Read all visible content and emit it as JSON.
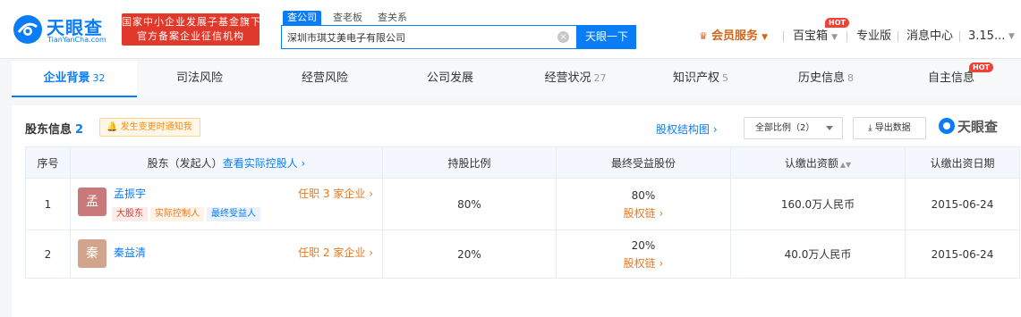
{
  "header": {
    "logo_cn": "天眼查",
    "logo_en": "TianYanCha.com",
    "slogan_line1": "国家中小企业发展子基金旗下",
    "slogan_line2": "官方备案企业征信机构",
    "search_tabs": [
      "查公司",
      "查老板",
      "查关系"
    ],
    "search_value": "深圳市琪艾美电子有限公司",
    "search_button": "天眼一下",
    "vip_label": "会员服务",
    "baibaoxiang": "百宝箱",
    "hot_badge": "HOT",
    "pro_version": "专业版",
    "message_center": "消息中心",
    "user_truncated": "3.15..."
  },
  "tabs": [
    {
      "label": "企业背景",
      "count": "32",
      "active": true
    },
    {
      "label": "司法风险",
      "count": ""
    },
    {
      "label": "经营风险",
      "count": ""
    },
    {
      "label": "公司发展",
      "count": ""
    },
    {
      "label": "经营状况",
      "count": "27"
    },
    {
      "label": "知识产权",
      "count": "5"
    },
    {
      "label": "历史信息",
      "count": "8"
    },
    {
      "label": "自主信息",
      "count": ""
    }
  ],
  "tab_hot_badge": "HOT",
  "section": {
    "title": "股东信息",
    "count": "2",
    "notify_label": "发生变更时通知我",
    "equity_chart_link": "股权结构图",
    "ratio_select": "全部比例（2）",
    "export_label": "导出数据",
    "watermark": "天眼查"
  },
  "table": {
    "headers": {
      "index": "序号",
      "shareholder": "股东（发起人）",
      "controller_link": "查看实际控股人",
      "ratio": "持股比例",
      "final_share": "最终受益股份",
      "subscribed": "认缴出资额",
      "date": "认缴出资日期"
    },
    "rows": [
      {
        "index": "1",
        "avatar_char": "孟",
        "avatar_color": "#c9797a",
        "name": "孟振宇",
        "job_link": "任职 3 家企业",
        "tags": [
          "大股东",
          "实际控制人",
          "最终受益人"
        ],
        "ratio": "80%",
        "final_share": "80%",
        "chain_link": "股权链",
        "subscribed": "160.0万人民币",
        "date": "2015-06-24"
      },
      {
        "index": "2",
        "avatar_char": "秦",
        "avatar_color": "#d3a48c",
        "name": "秦益清",
        "job_link": "任职 2 家企业",
        "tags": [],
        "ratio": "20%",
        "final_share": "20%",
        "chain_link": "股权链",
        "subscribed": "40.0万人民币",
        "date": "2015-06-24"
      }
    ]
  },
  "colors": {
    "brand_blue": "#0a7cf5",
    "slogan_red": "#e0392b",
    "vip_orange": "#d4661b"
  }
}
